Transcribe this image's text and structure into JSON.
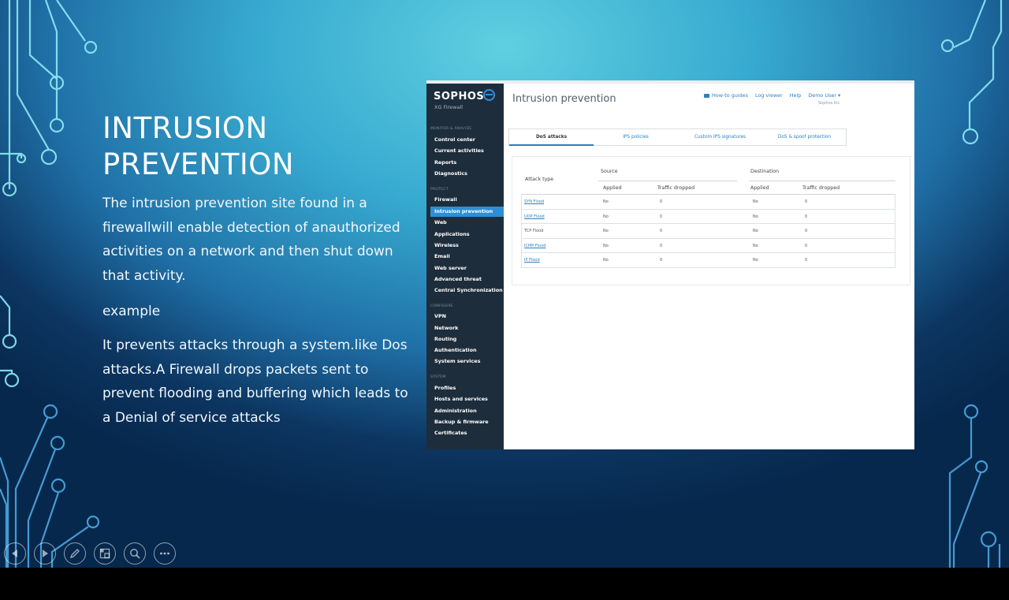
{
  "slide": {
    "title": "INTRUSION PREVENTION",
    "paragraphs": [
      "The intrusion prevention site found in a firewallwill enable detection of anauthorized activities on a network and then shut down that activity.",
      "example",
      "It prevents attacks through a system.like Dos attacks.A Firewall drops packets sent to prevent flooding and buffering which leads to a Denial of service attacks"
    ]
  },
  "screenshot": {
    "brand": "SOPHOS",
    "product": "XG Firewall",
    "page_title": "Intrusion prevention",
    "top_links": [
      "How-to guides",
      "Log viewer",
      "Help",
      "Demo User ▾"
    ],
    "company": "Sophos Inc",
    "sections": [
      {
        "label": "MONITOR & ANALYZE",
        "items": [
          "Control center",
          "Current activities",
          "Reports",
          "Diagnostics"
        ]
      },
      {
        "label": "PROTECT",
        "items": [
          "Firewall",
          "Intrusion prevention",
          "Web",
          "Applications",
          "Wireless",
          "Email",
          "Web server",
          "Advanced threat",
          "Central Synchronization"
        ]
      },
      {
        "label": "CONFIGURE",
        "items": [
          "VPN",
          "Network",
          "Routing",
          "Authentication",
          "System services"
        ]
      },
      {
        "label": "SYSTEM",
        "items": [
          "Profiles",
          "Hosts and services",
          "Administration",
          "Backup & firmware",
          "Certificates"
        ]
      }
    ],
    "active_item": "Intrusion prevention",
    "tabs": [
      "DoS attacks",
      "IPS policies",
      "Custom IPS signatures",
      "DoS & spoof protection"
    ],
    "active_tab": "DoS attacks",
    "table": {
      "attack_type_header": "Attack type",
      "source_header": "Source",
      "destination_header": "Destination",
      "sub_headers": [
        "Applied",
        "Traffic dropped",
        "Applied",
        "Traffic dropped"
      ],
      "rows": [
        [
          "SYN Flood",
          "No",
          "0",
          "No",
          "0"
        ],
        [
          "UDP Flood",
          "No",
          "0",
          "No",
          "0"
        ],
        [
          "TCP Flood",
          "No",
          "0",
          "No",
          "0"
        ],
        [
          "ICMP Flood",
          "No",
          "0",
          "No",
          "0"
        ],
        [
          "IP Flood",
          "No",
          "0",
          "No",
          "0"
        ]
      ]
    }
  },
  "controls": [
    "previous-icon",
    "next-icon",
    "pen-icon",
    "slides-icon",
    "zoom-icon",
    "more-icon"
  ],
  "colors": {
    "accent": "#2d8fd5",
    "sidebar": "#1d2d3c",
    "title": "#ffffff"
  }
}
